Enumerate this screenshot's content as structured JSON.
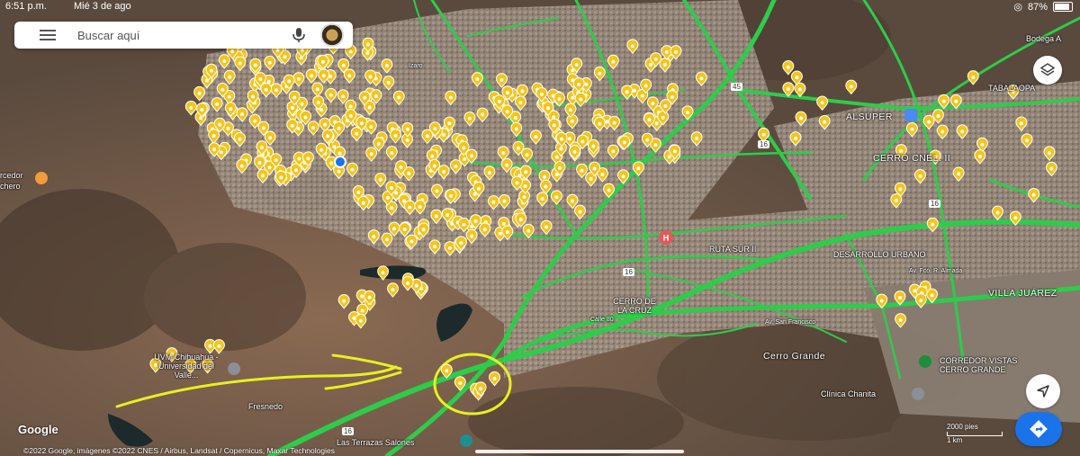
{
  "status_bar": {
    "time": "6:51 p.m.",
    "date": "Mié 3 de ago",
    "battery": "87%",
    "battery_level": 0.87
  },
  "search": {
    "placeholder": "Buscar aquí",
    "menu_icon": "hamburger-menu-icon",
    "mic_icon": "microphone-icon",
    "avatar": "profile-avatar"
  },
  "map": {
    "type": "satellite",
    "traffic_layer": true,
    "colors": {
      "traffic_green": "#2ecc4a",
      "pin_yellow": "#f5c518",
      "terrain": "#6b5a4a",
      "annotation": "#e8f020"
    },
    "labels": [
      "Bodega A",
      "TABALAOPA",
      "ALSUPER",
      "CERRO CNEL. II",
      "DESARROLLO URBANO",
      "RUTA SUR II",
      "VILLA JUÁREZ",
      "CERRO DE LA CRUZ",
      "Cerro Grande",
      "CORREDOR VISTAS CERRO GRANDE",
      "Clínica Chanita",
      "Fresnedo",
      "UVM Chihuahua - Universidad del Valle...",
      "Las Terrazas Salones",
      "rcedor",
      "chero",
      "Calle 80",
      "Izaro",
      "Av. San Francisco",
      "Av. Fco. R. Almada"
    ],
    "road_shields": [
      "45",
      "16",
      "16",
      "16",
      "16"
    ]
  },
  "attribution": {
    "logo": "Google",
    "text": "©2022 Google, imágenes ©2022 CNES / Airbus, Landsat / Copernicus, Maxar Technologies",
    "scale": "2000 pies",
    "scale_metric": "1 km"
  },
  "buttons": {
    "layers_icon": "layers-icon",
    "compass_icon": "compass-navigation-icon",
    "directions_icon": "directions-icon"
  }
}
